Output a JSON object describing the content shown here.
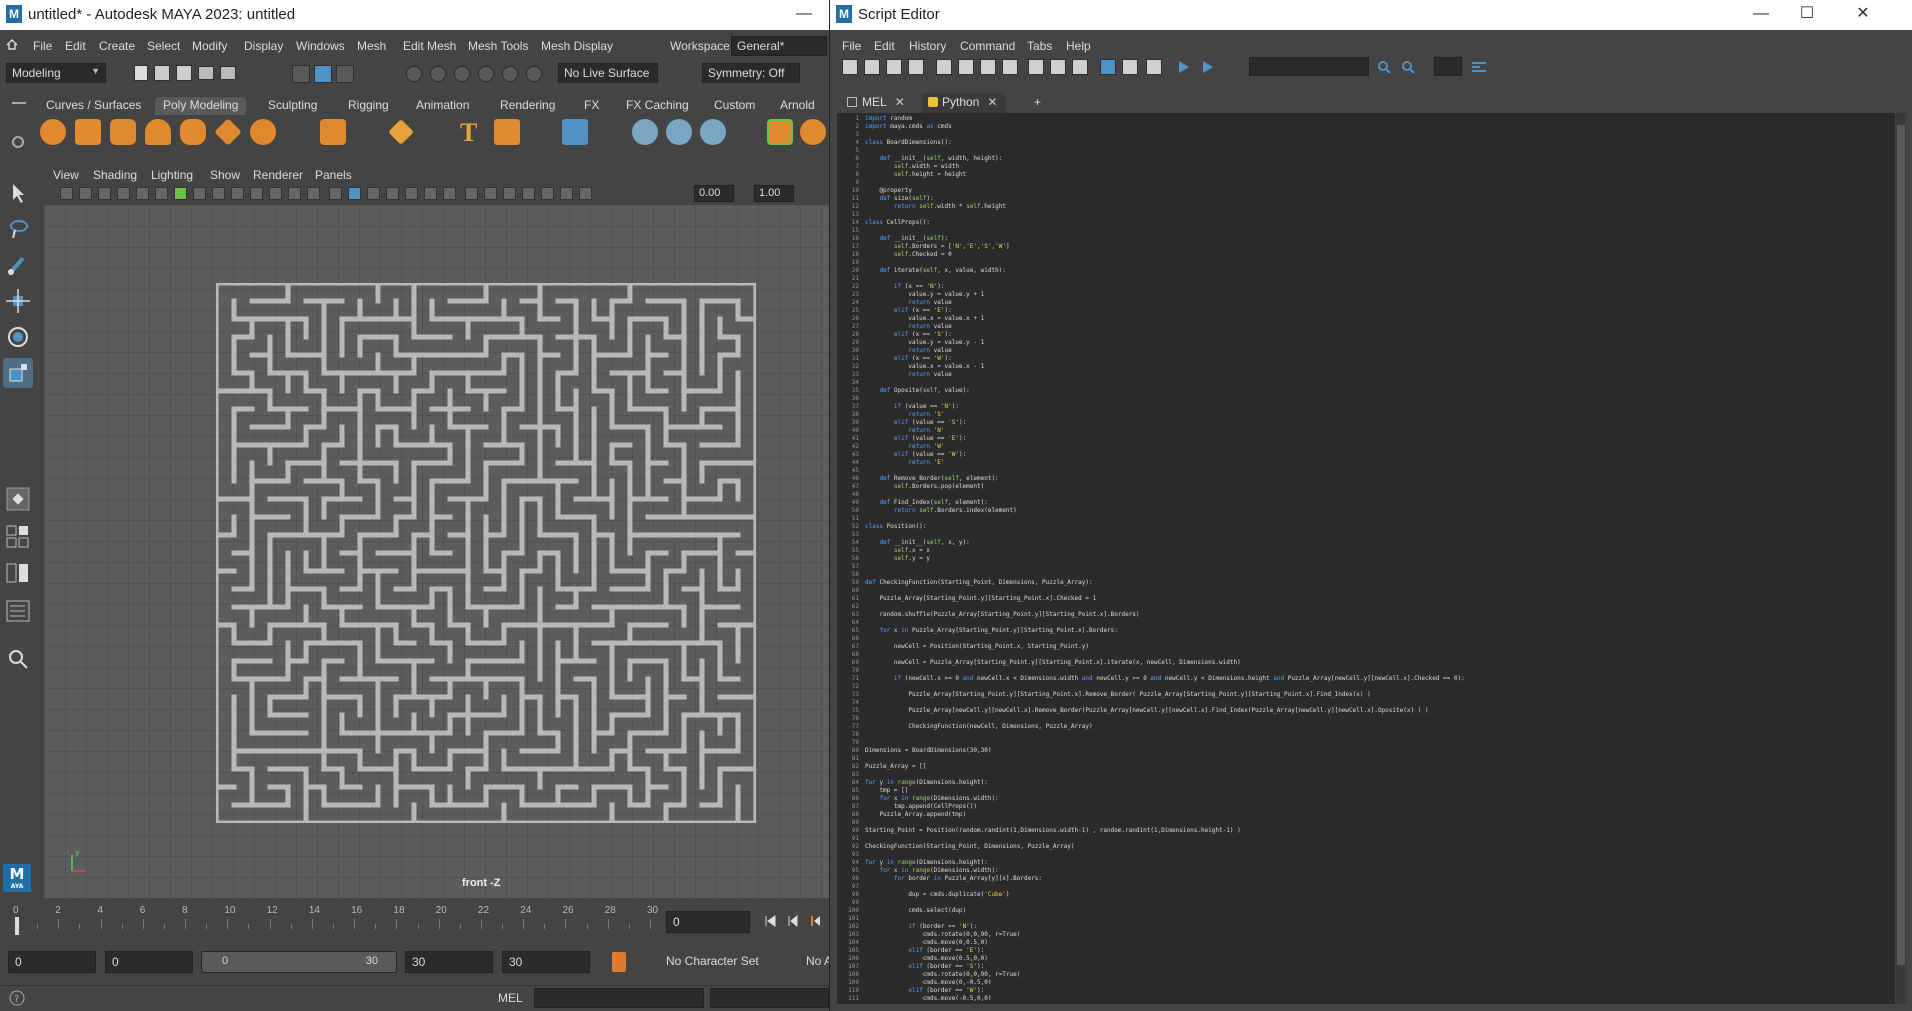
{
  "maya": {
    "title": "untitled* - Autodesk MAYA 2023: untitled",
    "menus": [
      "File",
      "Edit",
      "Create",
      "Select",
      "Modify",
      "Display",
      "Windows",
      "Mesh",
      "Edit Mesh",
      "Mesh Tools",
      "Mesh Display"
    ],
    "workspace_label": "Workspace:",
    "workspace_value": "General*",
    "mode_value": "Modeling",
    "live_surface": "No Live Surface",
    "symmetry": "Symmetry: Off",
    "shelf_tabs": [
      "Curves / Surfaces",
      "Poly Modeling",
      "Sculpting",
      "Rigging",
      "Animation",
      "Rendering",
      "FX",
      "FX Caching",
      "Custom",
      "Arnold"
    ],
    "shelf_active_index": 1,
    "panel_menus": [
      "View",
      "Shading",
      "Lighting",
      "Show",
      "Renderer",
      "Panels"
    ],
    "vp_field1": "0.00",
    "vp_field2": "1.00",
    "camera_label": "front -Z",
    "timeline_ticks": [
      "0",
      "2",
      "4",
      "6",
      "8",
      "10",
      "12",
      "14",
      "16",
      "18",
      "20",
      "22",
      "24",
      "26",
      "28",
      "30"
    ],
    "current_frame": "0",
    "range_start": "0",
    "range_anim_start": "0",
    "range_slider_start": "0",
    "range_slider_end": "30",
    "range_end": "30",
    "range_anim_end": "30",
    "character_set": "No Character Set",
    "anim_layer": "No A",
    "cmd_lang": "MEL",
    "logo": "M",
    "logo_sub": "AYA",
    "axis_y": "y"
  },
  "script_editor": {
    "title": "Script Editor",
    "menus": [
      "File",
      "Edit",
      "History",
      "Command",
      "Tabs",
      "Help"
    ],
    "tabs": [
      {
        "label": "MEL"
      },
      {
        "label": "Python"
      }
    ],
    "tab_add": "+",
    "active_tab": 1,
    "code": [
      "import random",
      "import maya.cmds as cmds",
      "",
      "class BoardDimensions():",
      "",
      "    def __init__(self, width, height):",
      "        self.width = width",
      "        self.height = height",
      "",
      "    @property",
      "    def size(self):",
      "        return self.width * self.height",
      "",
      "class CellProps():",
      "",
      "    def __init__(self):",
      "        self.Borders = ['N','E','S','W']",
      "        self.Checked = 0",
      "",
      "    def iterate(self, x, value, width):",
      "",
      "        if (x == 'N'):",
      "            value.y = value.y + 1",
      "            return value",
      "        elif (x == 'E'):",
      "            value.x = value.x + 1",
      "            return value",
      "        elif (x == 'S'):",
      "            value.y = value.y - 1",
      "            return value",
      "        elif (x == 'W'):",
      "            value.x = value.x - 1",
      "            return value",
      "",
      "    def Oposite(self, value):",
      "",
      "        if (value == 'N'):",
      "            return 'S'",
      "        elif (value == 'S'):",
      "            return 'N'",
      "        elif (value == 'E'):",
      "            return 'W'",
      "        elif (value == 'W'):",
      "            return 'E'",
      "",
      "    def Remove_Border(self, element):",
      "        self.Borders.pop(element)",
      "",
      "    def Find_Index(self, element):",
      "        return self.Borders.index(element)",
      "",
      "class Position():",
      "",
      "    def __init__(self, x, y):",
      "        self.x = x",
      "        self.y = y",
      "",
      "",
      "def CheckingFunction(Starting_Point, Dimensions, Puzzle_Array):",
      "",
      "    Puzzle_Array[Starting_Point.y][Starting_Point.x].Checked = 1",
      "",
      "    random.shuffle(Puzzle_Array[Starting_Point.y][Starting_Point.x].Borders)",
      "",
      "    for x in Puzzle_Array[Starting_Point.y][Starting_Point.x].Borders:",
      "",
      "        newCell = Position(Starting_Point.x, Starting_Point.y)",
      "",
      "        newCell = Puzzle_Array[Starting_Point.y][Starting_Point.x].iterate(x, newCell, Dimensions.width)",
      "",
      "        if (newCell.x >= 0 and newCell.x < Dimensions.width and newCell.y >= 0 and newCell.y < Dimensions.height and Puzzle_Array[newCell.y][newCell.x].Checked == 0):",
      "",
      "            Puzzle_Array[Starting_Point.y][Starting_Point.x].Remove_Border( Puzzle_Array[Starting_Point.y][Starting_Point.x].Find_Index(x) )",
      "",
      "            Puzzle_Array[newCell.y][newCell.x].Remove_Border(Puzzle_Array[newCell.y][newCell.x].Find_Index(Puzzle_Array[newCell.y][newCell.x].Oposite(x) ) )",
      "",
      "            CheckingFunction(newCell, Dimensions, Puzzle_Array)",
      "",
      "",
      "Dimensions = BoardDimensions(30,30)",
      "",
      "Puzzle_Array = []",
      "",
      "for y in range(Dimensions.height):",
      "    tmp = []",
      "    for x in range(Dimensions.width):",
      "        tmp.append(CellProps())",
      "    Puzzle_Array.append(tmp)",
      "",
      "Starting_Point = Position(random.randint(1,Dimensions.width-1) , random.randint(1,Dimensions.height-1) )",
      "",
      "CheckingFunction(Starting_Point, Dimensions, Puzzle_Array)",
      "",
      "for y in range(Dimensions.height):",
      "    for x in range(Dimensions.width):",
      "        for border in Puzzle_Array[y][x].Borders:",
      "",
      "            dup = cmds.duplicate('Cube')",
      "",
      "            cmds.select(dup)",
      "",
      "            if (border == 'N'):",
      "                cmds.rotate(0,0,90, r=True)",
      "                cmds.move(0,0.5,0)",
      "            elif (border == 'E'):",
      "                cmds.move(0.5,0,0)",
      "            elif (border == 'S'):",
      "                cmds.rotate(0,0,90, r=True)",
      "                cmds.move(0,-0.5,0)",
      "            elif (border == 'W'):",
      "                cmds.move(-0.5,0,0)"
    ]
  },
  "colors": {
    "code_bg": "#2b2b2b",
    "keyword": "#4fa3ff",
    "string": "#e8d44d",
    "builtin": "#9bd16a",
    "text": "#dddddd"
  }
}
